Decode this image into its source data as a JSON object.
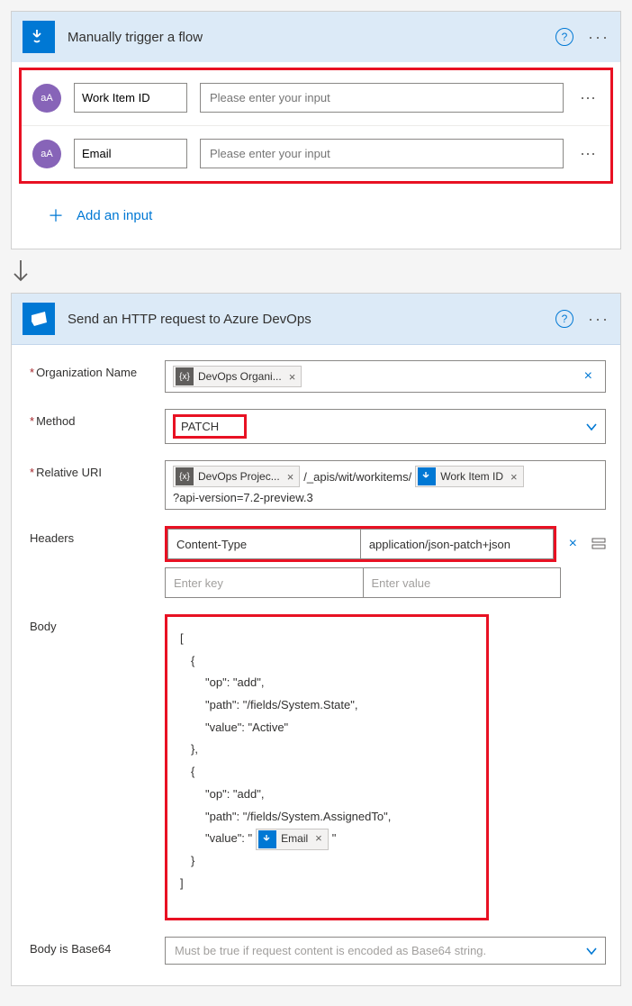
{
  "trigger": {
    "title": "Manually trigger a flow",
    "inputs": [
      {
        "label": "Work Item ID",
        "placeholder": "Please enter your input"
      },
      {
        "label": "Email",
        "placeholder": "Please enter your input"
      }
    ],
    "add_input": "Add an input"
  },
  "action": {
    "title": "Send an HTTP request to Azure DevOps",
    "fields": {
      "org_label": "Organization Name",
      "org_token": "DevOps Organi...",
      "method_label": "Method",
      "method_value": "PATCH",
      "uri_label": "Relative URI",
      "uri_token_project": "DevOps Projec...",
      "uri_text1": "/_apis/wit/workitems/",
      "uri_token_wid": "Work Item ID",
      "uri_text2": "?api-version=7.2-preview.3",
      "headers_label": "Headers",
      "header_key": "Content-Type",
      "header_val": "application/json-patch+json",
      "header_key_ph": "Enter key",
      "header_val_ph": "Enter value",
      "body_label": "Body",
      "body_lines": {
        "l0": "[",
        "l1": "{",
        "l2": "\"op\": \"add\",",
        "l3": "\"path\": \"/fields/System.State\",",
        "l4": "\"value\": \"Active\"",
        "l5": "},",
        "l6": "{",
        "l7": "\"op\": \"add\",",
        "l8": "\"path\": \"/fields/System.AssignedTo\",",
        "l9a": "\"value\": \"",
        "l9_token": "Email",
        "l9b": "\"",
        "l10": "}",
        "l11": "]"
      },
      "base64_label": "Body is Base64",
      "base64_ph": "Must be true if request content is encoded as Base64 string."
    }
  }
}
